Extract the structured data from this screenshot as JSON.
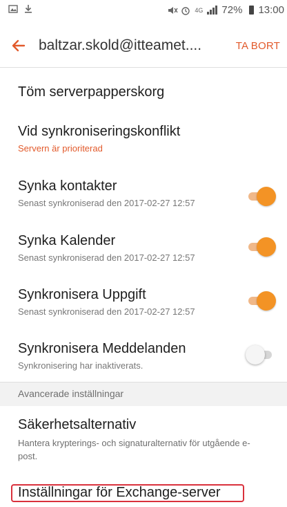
{
  "status_bar": {
    "icons_left": [
      "image-icon",
      "download-icon"
    ],
    "icons_right": [
      "mute-icon",
      "alarm-icon",
      "4g-icon",
      "signal-icon"
    ],
    "network": "4G",
    "battery": "72%",
    "time": "13:00"
  },
  "header": {
    "title": "baltzar.skold@itteamet....",
    "delete_label": "TA BORT",
    "accent_color": "#e25a2b"
  },
  "items": {
    "empty_trash": {
      "title": "Töm serverpapperskorg"
    },
    "sync_conflict": {
      "title": "Vid synkroniseringskonflikt",
      "subtitle": "Servern är prioriterad"
    },
    "sync_contacts": {
      "title": "Synka kontakter",
      "subtitle": "Senast synkroniserad den 2017-02-27  12:57",
      "enabled": true
    },
    "sync_calendar": {
      "title": "Synka Kalender",
      "subtitle": "Senast synkroniserad den 2017-02-27  12:57",
      "enabled": true
    },
    "sync_tasks": {
      "title": "Synkronisera Uppgift",
      "subtitle": "Senast synkroniserad den 2017-02-27  12:57",
      "enabled": true
    },
    "sync_messages": {
      "title": "Synkronisera Meddelanden",
      "subtitle": "Synkronisering har inaktiverats.",
      "enabled": false
    }
  },
  "advanced": {
    "section_label": "Avancerade inställningar",
    "security": {
      "title": "Säkerhetsalternativ",
      "subtitle": "Hantera krypterings- och signaturalternativ för utgående e-post."
    },
    "exchange": {
      "title": "Inställningar för Exchange-server"
    }
  }
}
